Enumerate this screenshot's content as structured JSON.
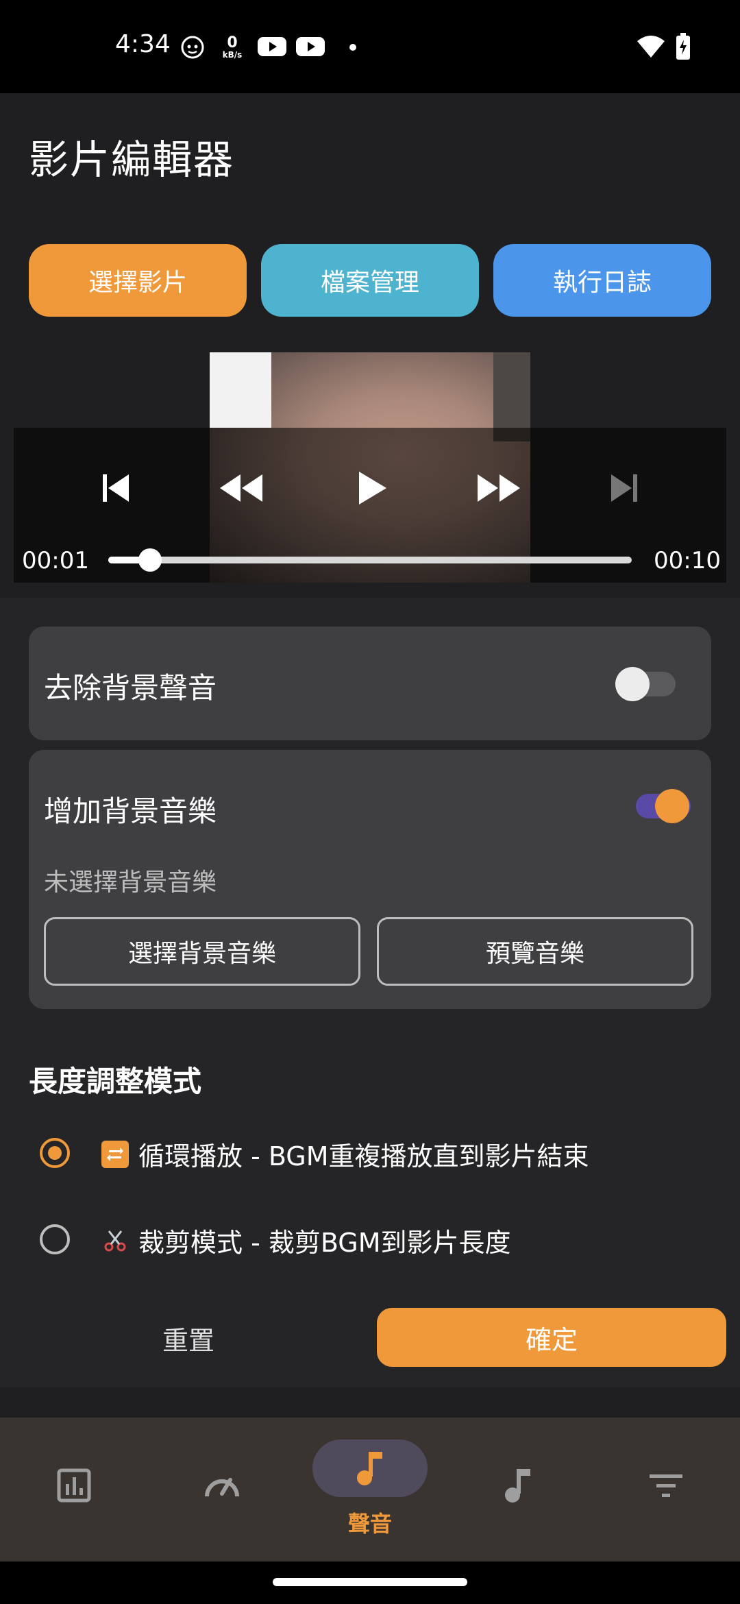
{
  "status": {
    "time": "4:34",
    "net_speed_value": "0",
    "net_speed_unit": "kB/s"
  },
  "app": {
    "title": "影片編輯器"
  },
  "top_buttons": {
    "select_video": "選擇影片",
    "file_manager": "檔案管理",
    "execution_log": "執行日誌"
  },
  "player": {
    "current_time": "00:01",
    "total_time": "00:10",
    "progress": 0.08
  },
  "remove_bg_sound": {
    "label": "去除背景聲音",
    "enabled": false
  },
  "add_bgm": {
    "label": "增加背景音樂",
    "enabled": true,
    "status": "未選擇背景音樂",
    "select_button": "選擇背景音樂",
    "preview_button": "預覽音樂"
  },
  "length_mode": {
    "title": "長度調整模式",
    "options": [
      {
        "emoji": "🔁",
        "label": "循環播放 - BGM重複播放直到影片結束",
        "selected": true
      },
      {
        "emoji": "✂️",
        "label": "裁剪模式 - 裁剪BGM到影片長度",
        "selected": false
      }
    ]
  },
  "actions": {
    "reset": "重置",
    "confirm": "確定"
  },
  "bottom_nav": {
    "active_index": 2,
    "items": [
      {
        "icon": "bar-chart-icon",
        "label": ""
      },
      {
        "icon": "speedometer-icon",
        "label": ""
      },
      {
        "icon": "music-note-icon",
        "label": "聲音"
      },
      {
        "icon": "music-note-icon",
        "label": ""
      },
      {
        "icon": "filter-icon",
        "label": ""
      }
    ]
  },
  "colors": {
    "accent_orange": "#f0993a",
    "teal": "#4eb3cf",
    "blue": "#4b95ea",
    "switch_on_track": "#5a4aa8"
  }
}
